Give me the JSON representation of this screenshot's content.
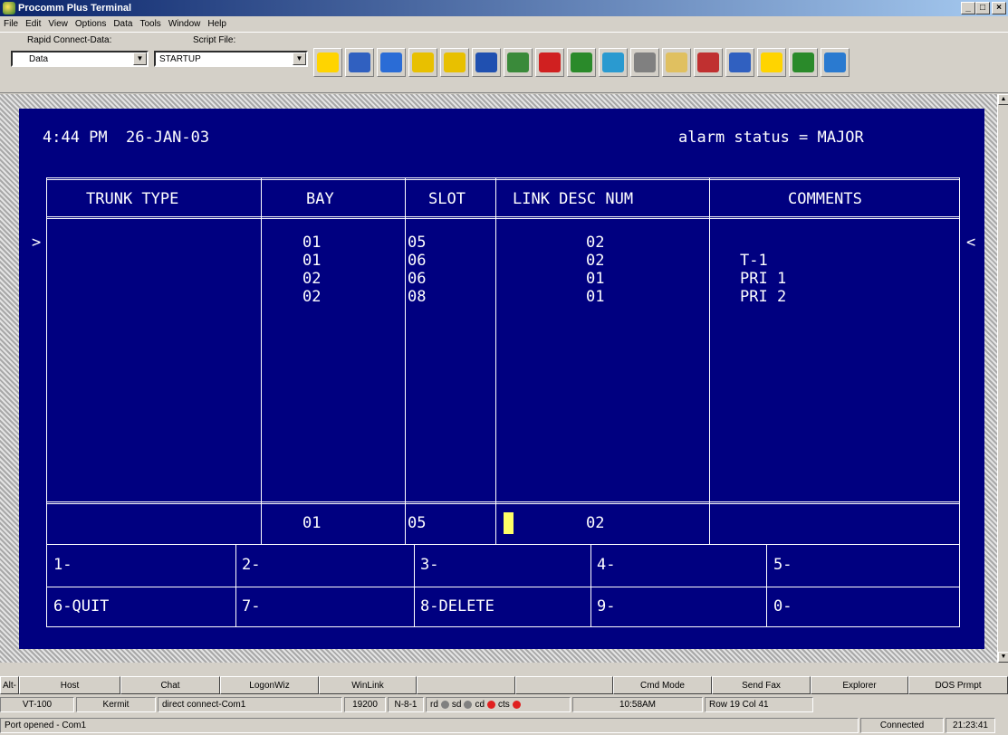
{
  "window": {
    "title": "Procomm Plus Terminal",
    "min": "_",
    "max": "□",
    "close": "×"
  },
  "menu": [
    "File",
    "Edit",
    "View",
    "Options",
    "Data",
    "Tools",
    "Window",
    "Help"
  ],
  "toolbar": {
    "rapid_label": "Rapid Connect-Data:",
    "rapid_value": "Data",
    "script_label": "Script File:",
    "script_value": "STARTUP",
    "icons": [
      "run-icon",
      "book-icon",
      "mode-icon",
      "upload-icon",
      "download-icon",
      "phonebook-icon",
      "modem-icon",
      "dial-icon",
      "monitor-icon",
      "fax-icon",
      "printer-icon",
      "capture-icon",
      "tools-icon",
      "key-icon",
      "cable-icon",
      "terminal-icon",
      "web-icon"
    ],
    "icon_colors": [
      "#ffd400",
      "#3060c0",
      "#2a6cd6",
      "#e8c000",
      "#e8c000",
      "#2050b0",
      "#3a8a3a",
      "#d02020",
      "#2a8a2a",
      "#2a9ad0",
      "#808080",
      "#e0c060",
      "#c03030",
      "#3060c0",
      "#ffd400",
      "#2a8a2a",
      "#2a7ad0"
    ]
  },
  "screen": {
    "time": "4:44 PM",
    "date": "26-JAN-03",
    "alarm": "alarm status = MAJOR",
    "headers": [
      "TRUNK TYPE",
      "BAY",
      "SLOT",
      "LINK DESC NUM",
      "COMMENTS"
    ],
    "bay_values": [
      "01",
      "01",
      "02",
      "02"
    ],
    "slot_values": [
      "05",
      "06",
      "06",
      "08"
    ],
    "link_values": [
      "02",
      "02",
      "01",
      "01"
    ],
    "comments": [
      "T-1",
      "PRI 1",
      "PRI 2"
    ],
    "left_marker": ">",
    "right_marker": "<",
    "input_row": {
      "bay": "01",
      "slot": "05",
      "link": "02"
    },
    "fkeys_row1": [
      "1-",
      "2-",
      "3-",
      "4-",
      "5-"
    ],
    "fkeys_row2": [
      "6-QUIT",
      "7-",
      "8-DELETE",
      "9-",
      "0-"
    ]
  },
  "button_bar": [
    "Alt-",
    "Host",
    "Chat",
    "LogonWiz",
    "WinLink",
    "",
    "",
    "Cmd Mode",
    "Send Fax",
    "Explorer",
    "DOS Prmpt"
  ],
  "status": {
    "emulation": "VT-100",
    "protocol": "Kermit",
    "connection": "direct connect-Com1",
    "baud": "19200",
    "parity": "N-8-1",
    "rd": "rd",
    "sd": "sd",
    "cd": "cd",
    "cts": "cts",
    "clock": "10:58AM",
    "position": "Row 19  Col 41"
  },
  "bottom": {
    "message": "Port opened - Com1",
    "state": "Connected",
    "time": "21:23:41"
  }
}
